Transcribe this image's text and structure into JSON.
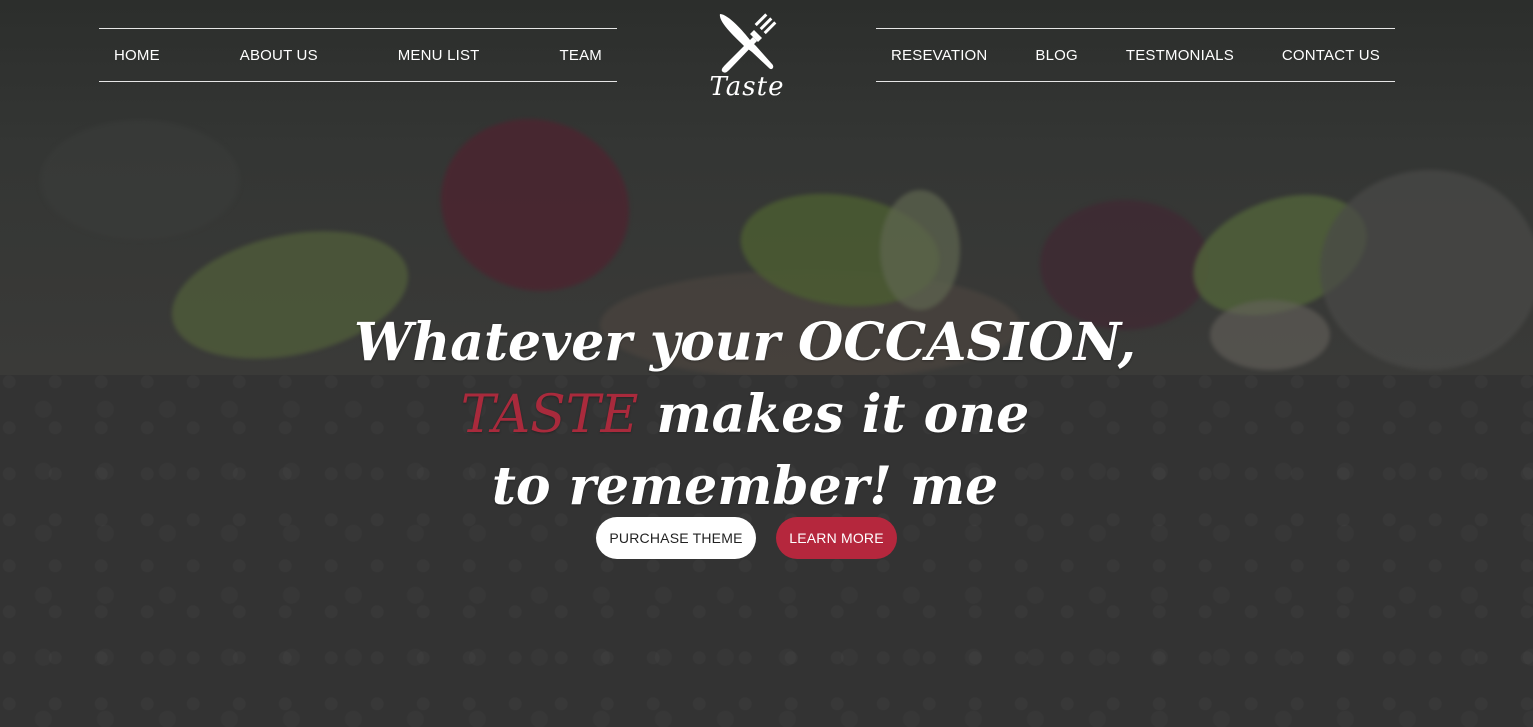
{
  "nav": {
    "left": [
      {
        "label": "HOME"
      },
      {
        "label": "ABOUT US"
      },
      {
        "label": "MENU LIST"
      },
      {
        "label": "TEAM"
      }
    ],
    "right": [
      {
        "label": "RESEVATION"
      },
      {
        "label": "BLOG"
      },
      {
        "label": "TESTMONIALS"
      },
      {
        "label": "CONTACT US"
      }
    ]
  },
  "logo": {
    "icon": "fork-knife-icon",
    "text": "Taste"
  },
  "hero": {
    "line1": "Whatever your OCCASION,",
    "accent": "TASTE",
    "line2_rest": " makes it one",
    "line3": "to remember! me"
  },
  "buttons": {
    "purchase": "PURCHASE THEME",
    "learn_more": "LEARN MORE"
  },
  "colors": {
    "accent": "#b5273d",
    "background": "#333333",
    "text": "#ffffff"
  }
}
